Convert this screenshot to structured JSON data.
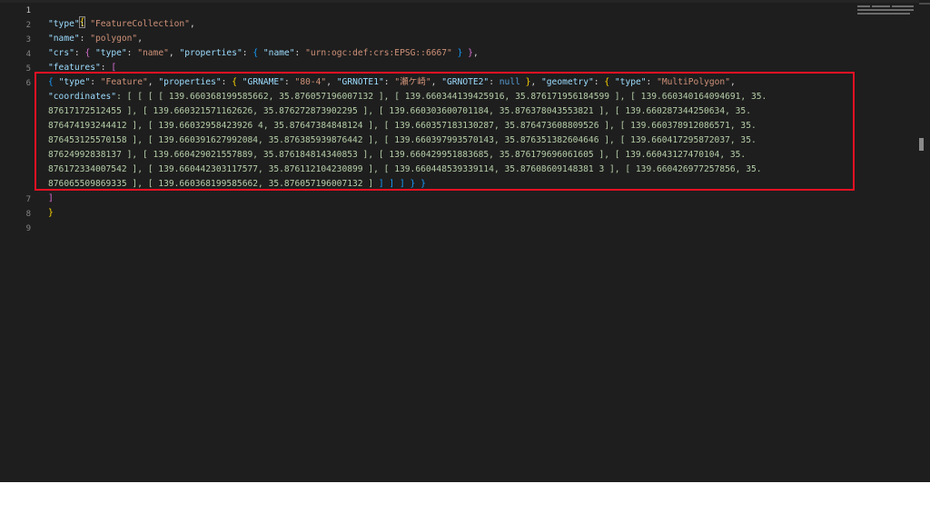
{
  "editor": {
    "line_numbers": [
      "1",
      "2",
      "3",
      "4",
      "5",
      "6",
      "7",
      "8",
      "9"
    ],
    "lines": {
      "l1": {
        "brace": "{"
      },
      "l2": {
        "key": "\"type\"",
        "colon": ": ",
        "value": "\"FeatureCollection\"",
        "comma": ","
      },
      "l3": {
        "key": "\"name\"",
        "colon": ": ",
        "value": "\"polygon\"",
        "comma": ","
      },
      "l4": {
        "key": "\"crs\"",
        "colon": ": ",
        "ob": "{ ",
        "k1": "\"type\"",
        "c1": ": ",
        "v1": "\"name\"",
        "c2": ", ",
        "k2": "\"properties\"",
        "c3": ": ",
        "ob2": "{ ",
        "k3": "\"name\"",
        "c4": ": ",
        "v3": "\"urn:ogc:def:crs:EPSG::6667\"",
        "cb2": " }",
        "cb": " }",
        "comma": ","
      },
      "l5": {
        "key": "\"features\"",
        "colon": ": ",
        "bracket": "["
      },
      "l6a": {
        "ob": "{ ",
        "k1": "\"type\"",
        "c1": ": ",
        "v1": "\"Feature\"",
        "c2": ", ",
        "k2": "\"properties\"",
        "c3": ": ",
        "ob2": "{ ",
        "k3": "\"GRNAME\"",
        "c4": ": ",
        "v3": "\"80-4\"",
        "c5": ", ",
        "k4": "\"GRNOTE1\"",
        "c6": ": ",
        "v4": "\"瀬ケ崎\"",
        "c7": ", ",
        "k5": "\"GRNOTE2\"",
        "c8": ": ",
        "v5": "null",
        "cb2": " }",
        "c9": ", ",
        "k6": "\"geometry\"",
        "c10": ": ",
        "ob3": "{ ",
        "k7": "\"type\"",
        "c11": ": ",
        "v7": "\"MultiPolygon\"",
        "c12": ","
      },
      "l6b": {
        "k": "\"coordinates\"",
        "rest": ": [ [ [ [ 139.660368199585662, 35.876057196007132 ], [ 139.660344139425916, 35.876171956184599 ], [ 139.660340164094691, 35."
      },
      "l6c": "87617172512455 ], [ 139.660321571162626, 35.876272873902295 ], [ 139.660303600701184, 35.876378043553821 ], [ 139.660287344250634, 35.",
      "l6d": "876474193244412 ], [ 139.66032958423926 4, 35.87647384848124 ], [ 139.660357183130287, 35.876473608809526 ], [ 139.660378912086571, 35.",
      "l6e": "876453125570158 ], [ 139.660391627992084, 35.876385939876442 ], [ 139.660397993570143, 35.876351382604646 ], [ 139.660417295872037, 35.",
      "l6f": "87624992838137 ], [ 139.660429021557889, 35.876184814340853 ], [ 139.660429951883685, 35.876179696061605 ], [ 139.66043127470104, 35.",
      "l6g": "876172334007542 ], [ 139.660442303117577, 35.876112104230899 ], [ 139.660448539339114, 35.87608609148381 3 ], [ 139.660426977257856, 35.",
      "l6h": {
        "rest": "876065509869335 ], [ 139.660368199585662, 35.876057196007132 ]",
        "end": " ] ] ] } }"
      },
      "l7": {
        "bracket": "]"
      },
      "l8": {
        "brace": "}"
      }
    }
  },
  "colors": {
    "highlight_border": "#e81123",
    "background": "#1e1e1e"
  }
}
